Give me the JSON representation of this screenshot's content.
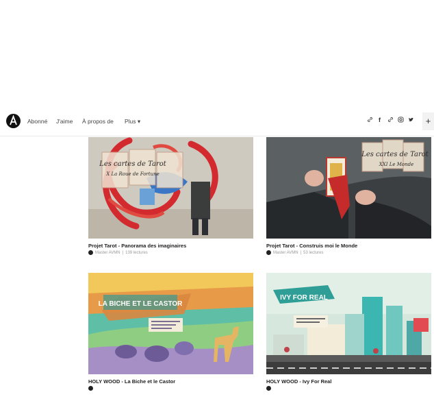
{
  "nav": {
    "links": [
      "Abonné",
      "J'aime",
      "À propos de",
      "Plus"
    ],
    "plus_chevron": "▾",
    "add_button": "+",
    "social_icons": [
      "link-icon",
      "facebook-icon",
      "link-icon",
      "instagram-icon",
      "twitter-icon"
    ]
  },
  "cards": [
    {
      "title": "Projet Tarot - Panorama des imaginaires",
      "author": "Master AVMN",
      "stats": "139 lectures",
      "overlay": [
        "Les cartes de Tarot",
        "X La Roue de Fortune"
      ]
    },
    {
      "title": "Projet Tarot - Construis moi le Monde",
      "author": "Master AVMN",
      "stats": "53 lectures",
      "overlay": [
        "Les cartes de Tarot",
        "XXI Le Monde"
      ]
    },
    {
      "title": "HOLY WOOD - La Biche et le Castor",
      "author": "",
      "stats": "",
      "overlay": [
        "LA BICHE ET LE CASTOR"
      ]
    },
    {
      "title": "HOLY WOOD - Ivy For Real",
      "author": "",
      "stats": "",
      "overlay": [
        "IVY FOR REAL"
      ]
    }
  ],
  "colors": {
    "nav_text": "#444444",
    "title_text": "#222222",
    "meta_text": "#999999"
  }
}
